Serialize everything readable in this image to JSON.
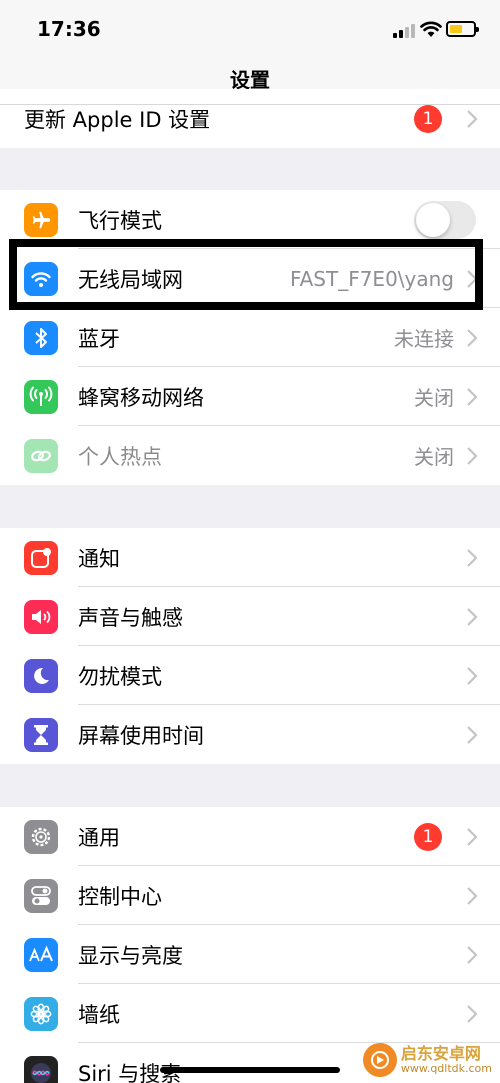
{
  "status_bar": {
    "time": "17:36"
  },
  "nav": {
    "title": "设置"
  },
  "top_row": {
    "label": "更新 Apple ID 设置",
    "badge": "1"
  },
  "group1": [
    {
      "label": "飞行模式",
      "icon": "airplane-icon",
      "icon_color": "#ff9500",
      "toggle": false
    },
    {
      "label": "无线局域网",
      "icon": "wifi-icon",
      "icon_color": "#1a8cff",
      "value": "FAST_F7E0\\yang"
    },
    {
      "label": "蓝牙",
      "icon": "bluetooth-icon",
      "icon_color": "#1a8cff",
      "value": "未连接"
    },
    {
      "label": "蜂窝移动网络",
      "icon": "cellular-icon",
      "icon_color": "#34c759",
      "value": "关闭"
    },
    {
      "label": "个人热点",
      "icon": "hotspot-icon",
      "icon_color": "#34c759",
      "value": "关闭",
      "disabled": true
    }
  ],
  "group2": [
    {
      "label": "通知",
      "icon": "notifications-icon",
      "icon_color": "#ff3b30"
    },
    {
      "label": "声音与触感",
      "icon": "sound-icon",
      "icon_color": "#ff2d55"
    },
    {
      "label": "勿扰模式",
      "icon": "moon-icon",
      "icon_color": "#5856d6"
    },
    {
      "label": "屏幕使用时间",
      "icon": "hourglass-icon",
      "icon_color": "#5856d6"
    }
  ],
  "group3": [
    {
      "label": "通用",
      "icon": "gear-icon",
      "icon_color": "#8e8e93",
      "badge": "1"
    },
    {
      "label": "控制中心",
      "icon": "switches-icon",
      "icon_color": "#8e8e93"
    },
    {
      "label": "显示与亮度",
      "icon": "text-size-icon",
      "icon_color": "#1a8cff"
    },
    {
      "label": "墙纸",
      "icon": "flower-icon",
      "icon_color": "#32ade6"
    },
    {
      "label": "Siri 与搜索",
      "icon": "siri-icon",
      "icon_color": "#222222"
    }
  ],
  "watermark": {
    "title": "启东安卓网",
    "url": "www.qdltdk.com"
  }
}
